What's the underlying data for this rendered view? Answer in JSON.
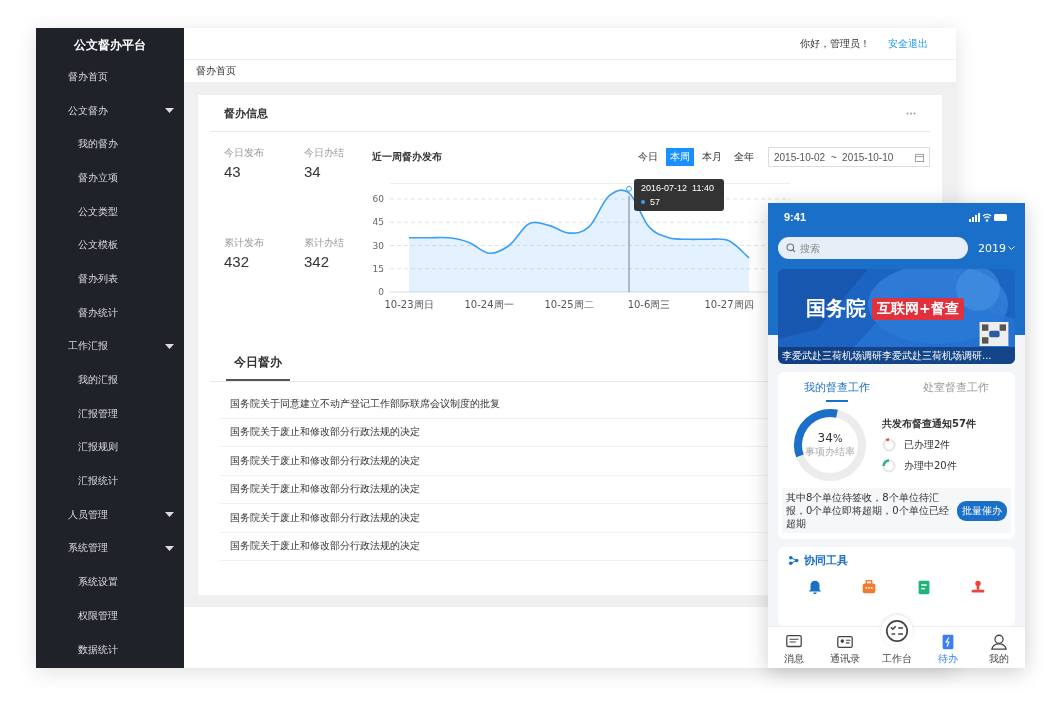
{
  "sidebar": {
    "title": "公文督办平台",
    "items": [
      {
        "label": "督办首页",
        "kind": "link"
      },
      {
        "label": "公文督办",
        "kind": "group",
        "children": [
          {
            "label": "我的督办"
          },
          {
            "label": "督办立项"
          },
          {
            "label": "公文类型"
          },
          {
            "label": "公文模板"
          },
          {
            "label": "督办列表"
          },
          {
            "label": "督办统计"
          }
        ]
      },
      {
        "label": "工作汇报",
        "kind": "group",
        "children": [
          {
            "label": "我的汇报"
          },
          {
            "label": "汇报管理"
          },
          {
            "label": "汇报规则"
          },
          {
            "label": "汇报统计"
          }
        ]
      },
      {
        "label": "人员管理",
        "kind": "group"
      },
      {
        "label": "系统管理",
        "kind": "group",
        "children": [
          {
            "label": "系统设置"
          },
          {
            "label": "权限管理"
          },
          {
            "label": "数据统计"
          }
        ]
      }
    ]
  },
  "header": {
    "greeting": "你好，管理员！",
    "logout": "安全退出"
  },
  "breadcrumb": "督办首页",
  "info_card": {
    "title": "督办信息",
    "stats": [
      {
        "label": "今日发布",
        "value": "43"
      },
      {
        "label": "今日办结",
        "value": "34"
      },
      {
        "label": "累计发布",
        "value": "432"
      },
      {
        "label": "累计办结",
        "value": "342"
      }
    ],
    "chart": {
      "title": "近一周督办发布",
      "periods": [
        {
          "label": "今日",
          "selected": false
        },
        {
          "label": "本周",
          "selected": true
        },
        {
          "label": "本月",
          "selected": false
        },
        {
          "label": "全年",
          "selected": false
        }
      ],
      "date_range": "2015-10-02  ~  2015-10-10",
      "tooltip": {
        "time": "2016-07-12  11:40",
        "value": "57"
      },
      "chart_data": {
        "type": "area",
        "categories": [
          "10-23周日",
          null,
          null,
          null,
          "10-24周一",
          null,
          null,
          null,
          "10-25周二",
          null,
          null,
          null,
          "10-6周三",
          null,
          null,
          null,
          "10-27周四",
          null,
          null,
          null
        ],
        "series": [
          {
            "color": "#3ba0f5",
            "values": [
              35,
              35,
              35,
              32,
              25,
              30,
              44,
              43,
              38,
              42,
              62,
              64,
              42,
              35,
              34,
              34,
              33,
              22,
              null,
              null
            ]
          }
        ],
        "ylim": [
          0,
          70
        ],
        "yticks": [
          0,
          15,
          30,
          45,
          60
        ],
        "grid": true
      }
    }
  },
  "today": {
    "tab": "今日督办",
    "items": [
      "国务院关于同意建立不动产登记工作部际联席会议制度的批复",
      "国务院关于废止和修改部分行政法规的决定",
      "国务院关于废止和修改部分行政法规的决定",
      "国务院关于废止和修改部分行政法规的决定",
      "国务院关于废止和修改部分行政法规的决定",
      "国务院关于废止和修改部分行政法规的决定"
    ]
  },
  "phone": {
    "time": "9:41",
    "search_placeholder": "搜索",
    "year": "2019",
    "banner": {
      "title": "国务院",
      "badge": "互联网+督查",
      "caption": "李爱武赴三荷机场调研李爱武赴三荷机场调研..."
    },
    "tabs": [
      {
        "label": "我的督查工作",
        "selected": true
      },
      {
        "label": "处室督查工作",
        "selected": false
      }
    ],
    "rate": {
      "value": "34",
      "unit": "%",
      "label": "事项办结率",
      "level": 0.34
    },
    "total": "共发布督查通知57件",
    "statuses": [
      {
        "label": "已办理2件",
        "color": "#e8453c"
      },
      {
        "label": "办理中20件",
        "color": "#1fb47a"
      }
    ],
    "summary": "其中8个单位待签收，8个单位待汇报，0个单位即将超期，0个单位已经超期",
    "action": "批量催办",
    "tools_title": "协同工具",
    "nav": [
      {
        "label": "消息",
        "kind": "tab",
        "selected": false
      },
      {
        "label": "通讯录",
        "kind": "tab",
        "selected": false
      },
      {
        "label": "工作台",
        "kind": "center",
        "selected": false
      },
      {
        "label": "待办",
        "kind": "tab",
        "selected": true
      },
      {
        "label": "我的",
        "kind": "tab",
        "selected": false
      }
    ]
  }
}
